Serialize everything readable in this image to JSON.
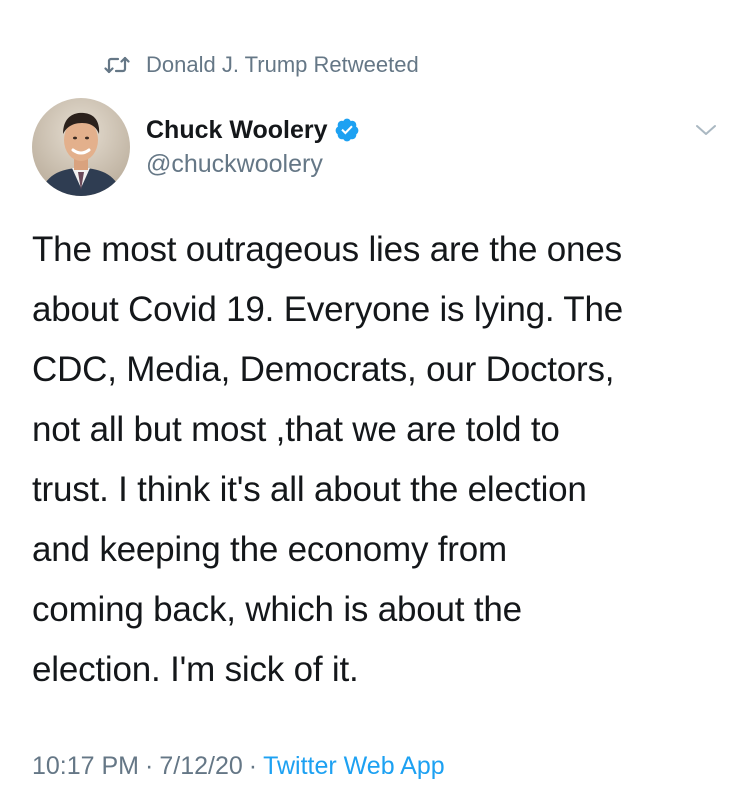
{
  "retweet": {
    "text": "Donald J. Trump Retweeted"
  },
  "author": {
    "display_name": "Chuck Woolery",
    "handle": "@chuckwoolery",
    "verified": true
  },
  "tweet": {
    "text": "The most outrageous lies are the ones\nabout Covid 19. Everyone is lying. The\nCDC, Media, Democrats, our Doctors,\nnot all but most ,that we are told to\ntrust. I think it's all about the election\nand keeping the economy from\ncoming back, which is about the\nelection. I'm sick of it.",
    "time": "10:17 PM",
    "date": "7/12/20",
    "separator": "·",
    "source": "Twitter Web App"
  },
  "icons": {
    "retweet": "retweet-icon",
    "verified": "verified-badge-icon",
    "more": "chevron-down-icon"
  },
  "colors": {
    "text": "#14171a",
    "secondary": "#657786",
    "accent": "#1da1f2"
  }
}
